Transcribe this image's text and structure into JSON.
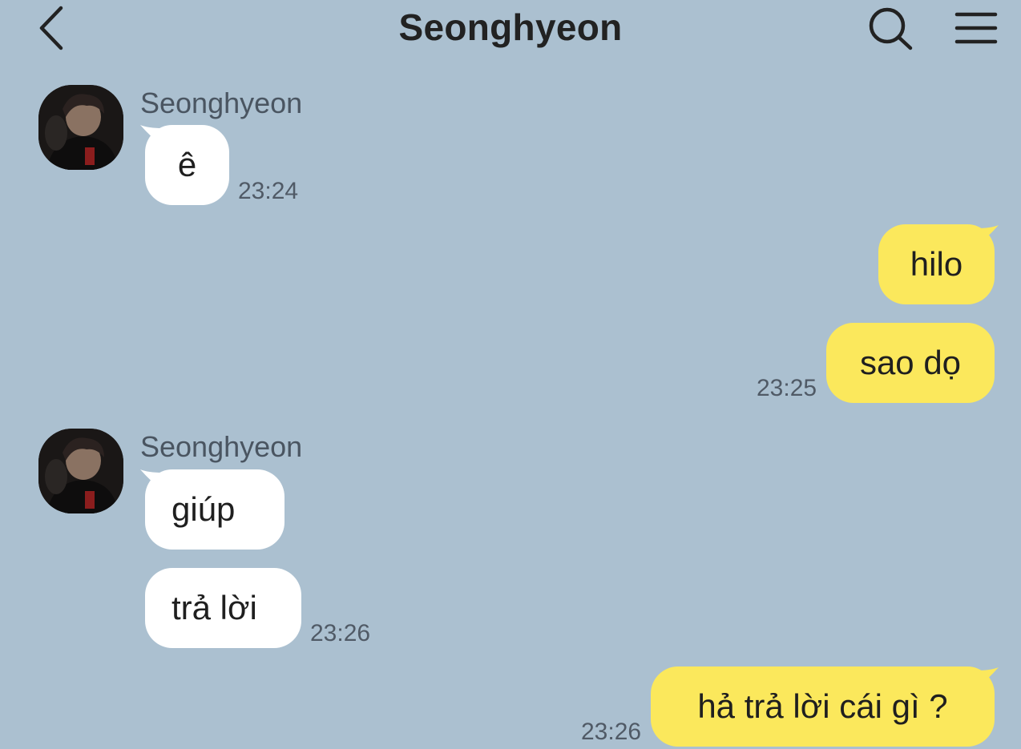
{
  "header": {
    "title": "Seonghyeon",
    "back_icon": "chevron-left-icon",
    "search_icon": "search-icon",
    "menu_icon": "hamburger-menu-icon"
  },
  "colors": {
    "background": "#abc0d0",
    "incoming_bubble": "#ffffff",
    "outgoing_bubble": "#fbe85c"
  },
  "messages": [
    {
      "sender": "Seonghyeon",
      "direction": "incoming",
      "bubbles": [
        "ê"
      ],
      "time": "23:24"
    },
    {
      "direction": "outgoing",
      "bubbles": [
        "hilo",
        "sao dọ"
      ],
      "time": "23:25"
    },
    {
      "sender": "Seonghyeon",
      "direction": "incoming",
      "bubbles": [
        "giúp",
        "trả lời"
      ],
      "time": "23:26"
    },
    {
      "direction": "outgoing",
      "bubbles": [
        "hả trả lời cái gì ?"
      ],
      "time": "23:26"
    }
  ]
}
